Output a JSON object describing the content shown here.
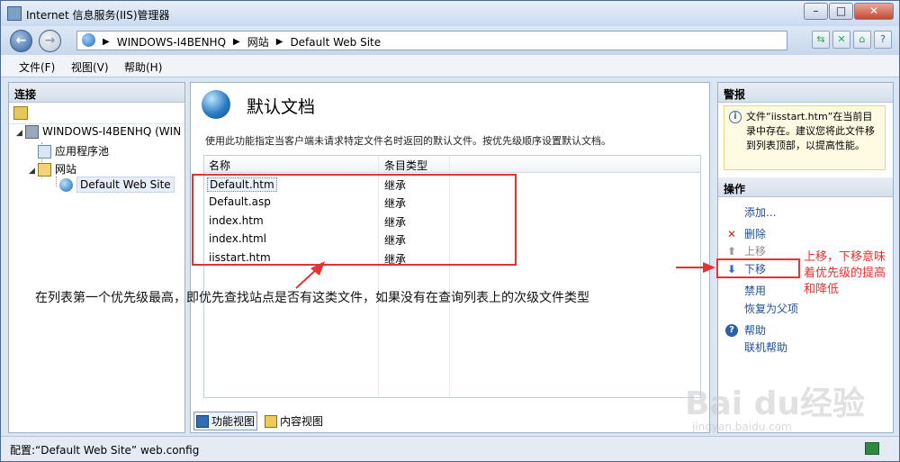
{
  "window": {
    "title": "Internet 信息服务(IIS)管理器"
  },
  "address": {
    "crumbs": [
      "WINDOWS-I4BENHQ",
      "网站",
      "Default Web Site"
    ]
  },
  "menu": [
    "文件(F)",
    "视图(V)",
    "帮助(H)"
  ],
  "connections": {
    "header": "连接",
    "tree": [
      {
        "label": "WINDOWS-I4BENHQ (WIN",
        "icon": "server-icon"
      },
      {
        "label": "应用程序池",
        "icon": "app-pool-icon"
      },
      {
        "label": "网站",
        "icon": "sites-folder-icon"
      },
      {
        "label": "Default Web Site",
        "icon": "website-globe-icon",
        "selected": true
      }
    ]
  },
  "feature": {
    "title": "默认文档",
    "description": "使用此功能指定当客户端未请求特定文件名时返回的默认文件。按优先级顺序设置默认文档。",
    "columns": [
      "名称",
      "条目类型"
    ],
    "rows": [
      {
        "name": "Default.htm",
        "type": "继承"
      },
      {
        "name": "Default.asp",
        "type": "继承"
      },
      {
        "name": "index.htm",
        "type": "继承"
      },
      {
        "name": "index.html",
        "type": "继承"
      },
      {
        "name": "iisstart.htm",
        "type": "继承"
      }
    ]
  },
  "view_tabs": [
    "功能视图",
    "内容视图"
  ],
  "alerts": {
    "header": "警报",
    "message": "文件“iisstart.htm”在当前目录中存在。建议您将此文件移到列表顶部，以提高性能。"
  },
  "actions": {
    "header": "操作",
    "items": [
      {
        "label": "添加...",
        "icon": "",
        "disabled": false
      },
      {
        "label": "删除",
        "icon": "delete-x-icon",
        "disabled": false
      },
      {
        "label": "上移",
        "icon": "up-arrow-icon",
        "disabled": true
      },
      {
        "label": "下移",
        "icon": "down-arrow-icon",
        "disabled": false
      },
      {
        "label": "禁用",
        "icon": "",
        "disabled": false
      },
      {
        "label": "恢复为父项",
        "icon": "",
        "disabled": false
      },
      {
        "label": "帮助",
        "icon": "help-icon",
        "disabled": false
      },
      {
        "label": "联机帮助",
        "icon": "",
        "disabled": false
      }
    ]
  },
  "status": {
    "text": "配置:“Default Web Site” web.config"
  },
  "annotations": {
    "main": "在列表第一个优先级最高，即优先查找站点是否有这类文件，如果没有在查询列表上的次级文件类型",
    "side_line1": "上移，下移意味",
    "side_line2": "着优先级的提高",
    "side_line3": "和降低",
    "color": "#e53333"
  },
  "watermark": {
    "brand": "Bai du经验",
    "url": "jingyan.baidu.com"
  }
}
